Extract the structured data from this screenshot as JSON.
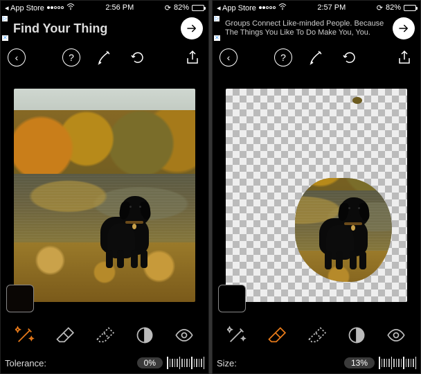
{
  "left": {
    "status": {
      "back_app": "App Store",
      "time": "2:56 PM",
      "battery_pct": "82%",
      "battery_fill": "82%"
    },
    "ad": {
      "text": "Find Your Thing"
    },
    "swatch_color": "#140a06",
    "tools": {
      "wand": true,
      "eraser": false,
      "pen": false,
      "mask": false,
      "eye": false
    },
    "param": {
      "label": "Tolerance:",
      "value": "0%"
    }
  },
  "right": {
    "status": {
      "back_app": "App Store",
      "time": "2:57 PM",
      "battery_pct": "82%",
      "battery_fill": "82%"
    },
    "ad": {
      "text": "Groups Connect Like-minded People. Because The Things You Like To Do Make You, You."
    },
    "swatch_color": "#000000",
    "tools": {
      "wand": false,
      "eraser": true,
      "pen": false,
      "mask": false,
      "eye": false
    },
    "param": {
      "label": "Size:",
      "value": "13%"
    }
  }
}
